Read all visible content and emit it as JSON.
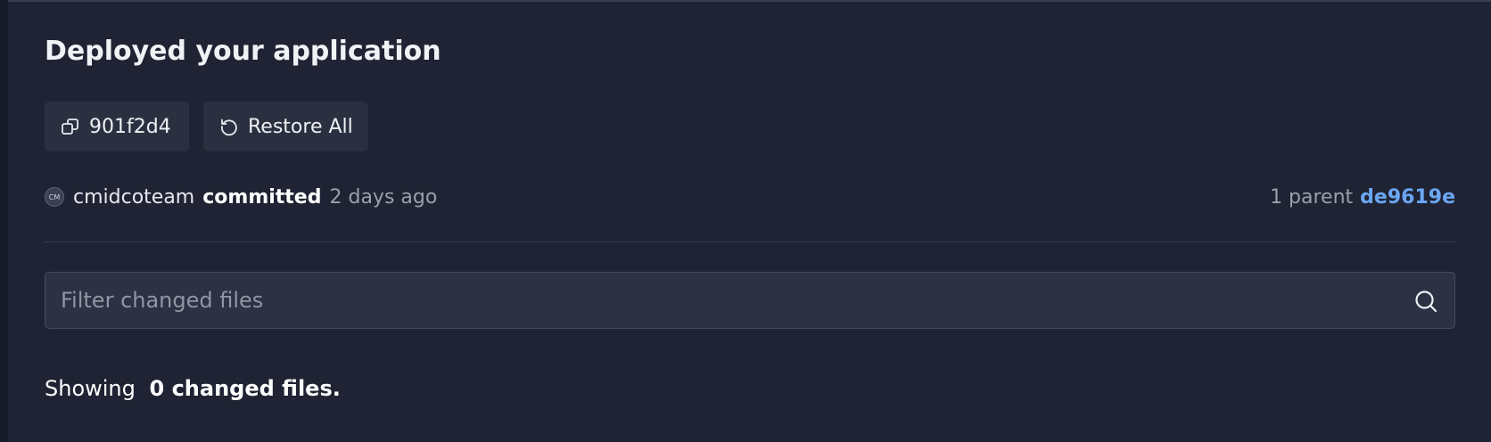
{
  "commit": {
    "title": "Deployed your application",
    "hash_button": {
      "label": "901f2d4",
      "icon": "copy-icon"
    },
    "restore_button": {
      "label": "Restore All",
      "icon": "restore-icon"
    },
    "author": {
      "avatar_initials": "CM",
      "name": "cmidcoteam"
    },
    "action": "committed",
    "time_ago": "2 days ago",
    "parent": {
      "label": "1 parent",
      "hash": "de9619e"
    }
  },
  "filter": {
    "placeholder": "Filter changed files",
    "value": "",
    "icon": "search-icon"
  },
  "summary": {
    "prefix": "Showing",
    "count_text": "0 changed files."
  },
  "colors": {
    "background": "#1f2333",
    "button_bg": "#2b3040",
    "link": "#6ba6f2",
    "muted": "#9aa0ad"
  }
}
